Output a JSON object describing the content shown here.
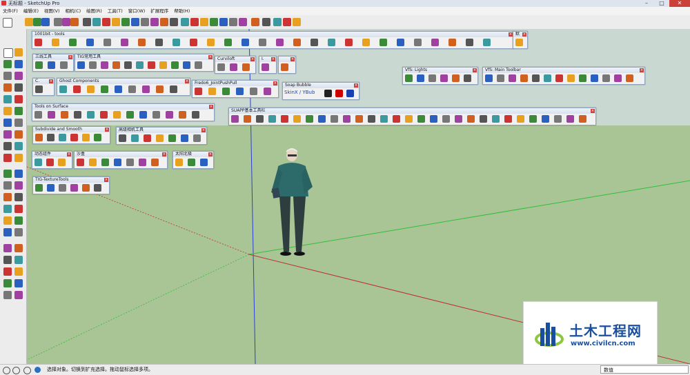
{
  "window": {
    "title": "无标题 - SketchUp Pro"
  },
  "menu": [
    "文件(F)",
    "编辑(E)",
    "视图(V)",
    "相机(C)",
    "绘图(R)",
    "工具(T)",
    "窗口(W)",
    "扩展程序",
    "帮助(H)"
  ],
  "panels": [
    {
      "id": "p1001bit",
      "title": "1001bit - tools",
      "icons": 27
    },
    {
      "id": "pmore",
      "title": "默",
      "icons": 1
    },
    {
      "id": "p3line",
      "title": "三线工具",
      "icons": 3
    },
    {
      "id": "ptig",
      "title": "TIG常用工具",
      "icons": 11
    },
    {
      "id": "pcurvi",
      "title": "Curviloft",
      "icons": 3
    },
    {
      "id": "ptiny",
      "title": "I.",
      "icons": 1
    },
    {
      "id": "ptiny2",
      "title": "",
      "icons": 1
    },
    {
      "id": "pc",
      "title": "C.",
      "icons": 1
    },
    {
      "id": "pghost",
      "title": "Ghost Components",
      "icons": 9
    },
    {
      "id": "pfredo",
      "title": "Fredo6_JointPushPull",
      "icons": 6
    },
    {
      "id": "psoap",
      "title": "Soap Bubble",
      "icons": 4
    },
    {
      "id": "pvflights",
      "title": "VfS: Lights",
      "icons": 6
    },
    {
      "id": "pvfmain",
      "title": "VfS: Main Toolbar",
      "icons": 13
    },
    {
      "id": "ptos",
      "title": "Tools on Surface",
      "icons": 13
    },
    {
      "id": "psuapp",
      "title": "SUAPP基本工具栏",
      "icons": 29
    },
    {
      "id": "psubd",
      "title": "Subdivide and Smooth",
      "icons": 6
    },
    {
      "id": "pcam",
      "title": "高级相机工具",
      "icons": 7
    },
    {
      "id": "pdyn",
      "title": "动态组件",
      "icons": 3
    },
    {
      "id": "psand",
      "title": "沙盒",
      "icons": 7
    },
    {
      "id": "psun",
      "title": "太阳北极",
      "icons": 3
    },
    {
      "id": "ptex",
      "title": "TIG-TextureTools",
      "icons": 6
    }
  ],
  "soap_bubble_label": "SkinX / YBub",
  "status": {
    "message": "选择对象。切换到扩充选择。拖动鼠标选择多项。",
    "vcb_label": "数值"
  },
  "watermark": {
    "main": "土木工程网",
    "url": "www.civilcn.com"
  }
}
